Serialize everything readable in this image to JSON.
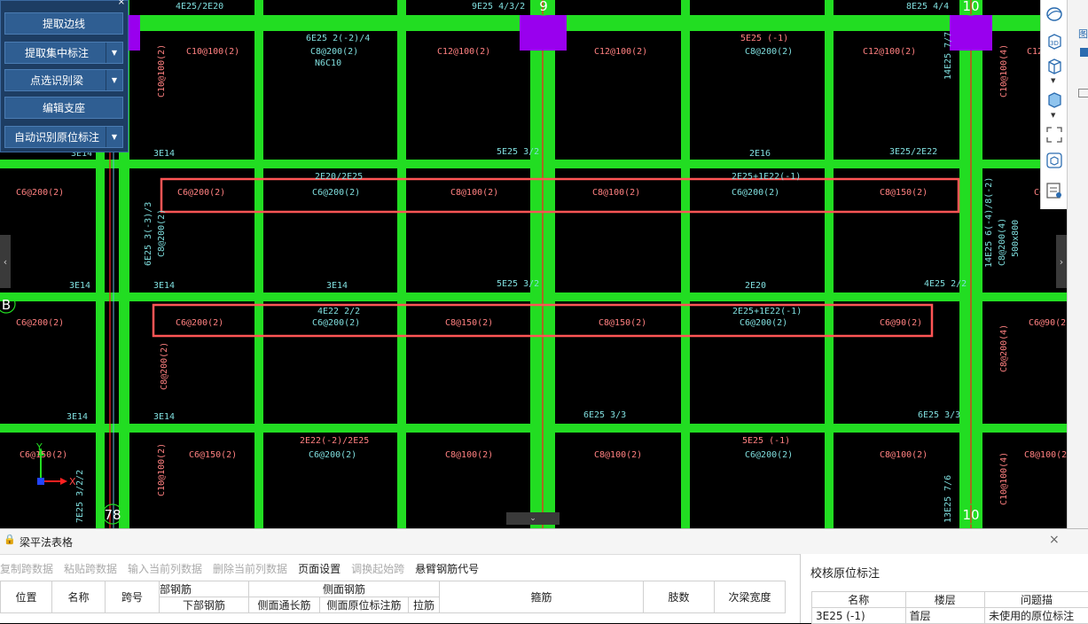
{
  "left_panel": {
    "buttons": [
      {
        "label": "提取边线",
        "dropdown": false
      },
      {
        "label": "提取集中标注",
        "dropdown": true
      },
      {
        "label": "点选识别梁",
        "dropdown": true
      },
      {
        "label": "编辑支座",
        "dropdown": false
      },
      {
        "label": "自动识别原位标注",
        "dropdown": true
      }
    ],
    "close": "×"
  },
  "cad": {
    "axis_labels": {
      "nine": "9",
      "ten_top": "10",
      "b": "B",
      "seventy_eight": "78",
      "ten_bottom": "10"
    },
    "ucs": {
      "x": "X",
      "y": "Y"
    },
    "annotations": [
      {
        "text": "4E25/2E20",
        "color": "cyan"
      },
      {
        "text": "9E25 4/3/2",
        "color": "cyan"
      },
      {
        "text": "8E25 4/4",
        "color": "cyan"
      },
      {
        "text": "6E25 2(-2)/4",
        "color": "cyan"
      },
      {
        "text": "C8@200(2)",
        "color": "cyan"
      },
      {
        "text": "N6C10",
        "color": "cyan"
      },
      {
        "text": "5E25 (-1)",
        "color": "pink"
      },
      {
        "text": "C8@200(2)",
        "color": "cyan"
      },
      {
        "text": "C10@100(2)",
        "color": "pink"
      },
      {
        "text": "C12@100(2)",
        "color": "pink"
      },
      {
        "text": "C12@100(2)",
        "color": "pink"
      },
      {
        "text": "C12@100(2)",
        "color": "pink"
      },
      {
        "text": "C12",
        "color": "pink"
      },
      {
        "text": "C10@100(2)",
        "color": "pink"
      },
      {
        "text": "14E25 7/7",
        "color": "cyan"
      },
      {
        "text": "C10@100(4)",
        "color": "pink"
      },
      {
        "text": "3E14",
        "color": "cyan"
      },
      {
        "text": "3E14",
        "color": "cyan"
      },
      {
        "text": "5E25 3/2",
        "color": "cyan"
      },
      {
        "text": "2E16",
        "color": "cyan"
      },
      {
        "text": "3E25/2E22",
        "color": "cyan"
      },
      {
        "text": "2E20/2E25",
        "color": "cyan"
      },
      {
        "text": "2E25+1E22(-1)",
        "color": "cyan"
      },
      {
        "text": "C6@200(2)",
        "color": "pink"
      },
      {
        "text": "C6@200(2)",
        "color": "pink"
      },
      {
        "text": "C6@200(2)",
        "color": "cyan"
      },
      {
        "text": "C8@100(2)",
        "color": "pink"
      },
      {
        "text": "C8@100(2)",
        "color": "pink"
      },
      {
        "text": "C6@200(2)",
        "color": "cyan"
      },
      {
        "text": "C8@150(2)",
        "color": "pink"
      },
      {
        "text": "C6",
        "color": "pink"
      },
      {
        "text": "6E25 3(-3)/3",
        "color": "cyan"
      },
      {
        "text": "C8@200(2)",
        "color": "cyan"
      },
      {
        "text": "14E25 6(-4)/8(-2)",
        "color": "cyan"
      },
      {
        "text": "C8@200(4)",
        "color": "cyan"
      },
      {
        "text": "500x800",
        "color": "cyan"
      },
      {
        "text": "3E14",
        "color": "cyan"
      },
      {
        "text": "3E14",
        "color": "cyan"
      },
      {
        "text": "3E14",
        "color": "cyan"
      },
      {
        "text": "5E25 3/2",
        "color": "cyan"
      },
      {
        "text": "2E20",
        "color": "cyan"
      },
      {
        "text": "4E25 2/2",
        "color": "cyan"
      },
      {
        "text": "C6@200(2)",
        "color": "pink"
      },
      {
        "text": "4E22 2/2",
        "color": "cyan"
      },
      {
        "text": "C6@200(2)",
        "color": "pink"
      },
      {
        "text": "C6@200(2)",
        "color": "cyan"
      },
      {
        "text": "C8@150(2)",
        "color": "pink"
      },
      {
        "text": "C8@150(2)",
        "color": "pink"
      },
      {
        "text": "2E25+1E22(-1)",
        "color": "cyan"
      },
      {
        "text": "C6@200(2)",
        "color": "cyan"
      },
      {
        "text": "C6@90(2)",
        "color": "pink"
      },
      {
        "text": "C6@90(2)",
        "color": "pink"
      },
      {
        "text": "C8@200(2)",
        "color": "pink"
      },
      {
        "text": "C8@200(4)",
        "color": "pink"
      },
      {
        "text": "3E14",
        "color": "cyan"
      },
      {
        "text": "3E14",
        "color": "cyan"
      },
      {
        "text": "6E25 3/3",
        "color": "cyan"
      },
      {
        "text": "6E25 3/3",
        "color": "cyan"
      },
      {
        "text": "C6@150(2)",
        "color": "pink"
      },
      {
        "text": "C6@150(2)",
        "color": "pink"
      },
      {
        "text": "2E22(-2)/2E25",
        "color": "pink"
      },
      {
        "text": "C6@200(2)",
        "color": "cyan"
      },
      {
        "text": "C8@100(2)",
        "color": "pink"
      },
      {
        "text": "C8@100(2)",
        "color": "pink"
      },
      {
        "text": "5E25 (-1)",
        "color": "pink"
      },
      {
        "text": "C6@200(2)",
        "color": "cyan"
      },
      {
        "text": "C8@100(2)",
        "color": "pink"
      },
      {
        "text": "C8@100(2)",
        "color": "pink"
      },
      {
        "text": "C10@100(2)",
        "color": "pink"
      },
      {
        "text": "7E25 3/2/2",
        "color": "cyan"
      },
      {
        "text": "13E25 7/6",
        "color": "cyan"
      },
      {
        "text": "C10@100(4)",
        "color": "pink"
      }
    ]
  },
  "colors": {
    "beam": "#22dd22",
    "pink": "#ff8080",
    "cyan": "#7fdede",
    "column": "#9900ee",
    "highlight": "#ff5555",
    "axis": "#ff2020"
  },
  "right_toolbar": {
    "icons": [
      "sphere-icon",
      "3d-view-icon",
      "cube-icon",
      "cube-filled-icon",
      "fullscreen-icon",
      "navigation-cube-icon",
      "list-view-icon"
    ],
    "label_3d": "3D"
  },
  "right_strip": {
    "char": "图"
  },
  "bottom": {
    "title": "梁平法表格",
    "close": "×",
    "toolbar": [
      {
        "label": "复制跨数据",
        "enabled": false
      },
      {
        "label": "粘贴跨数据",
        "enabled": false
      },
      {
        "label": "输入当前列数据",
        "enabled": false
      },
      {
        "label": "删除当前列数据",
        "enabled": false
      },
      {
        "label": "页面设置",
        "enabled": true
      },
      {
        "label": "调换起始跨",
        "enabled": false
      },
      {
        "label": "悬臂钢筋代号",
        "enabled": true
      }
    ],
    "table": {
      "col_position": "位置",
      "col_name": "名称",
      "col_span": "跨号",
      "group_bottom": "部钢筋",
      "col_bottom": "下部钢筋",
      "group_side": "侧面钢筋",
      "col_side_through": "侧面通长筋",
      "col_side_original": "侧面原位标注筋",
      "col_tie": "拉筋",
      "col_stirrup": "箍筋",
      "col_legs": "肢数",
      "col_secondary_width": "次梁宽度"
    },
    "verify_panel": {
      "title": "校核原位标注",
      "columns": [
        "名称",
        "楼层",
        "问题描"
      ],
      "rows": [
        [
          "3E25 (-1)",
          "首层",
          "未使用的原位标注"
        ]
      ]
    }
  }
}
